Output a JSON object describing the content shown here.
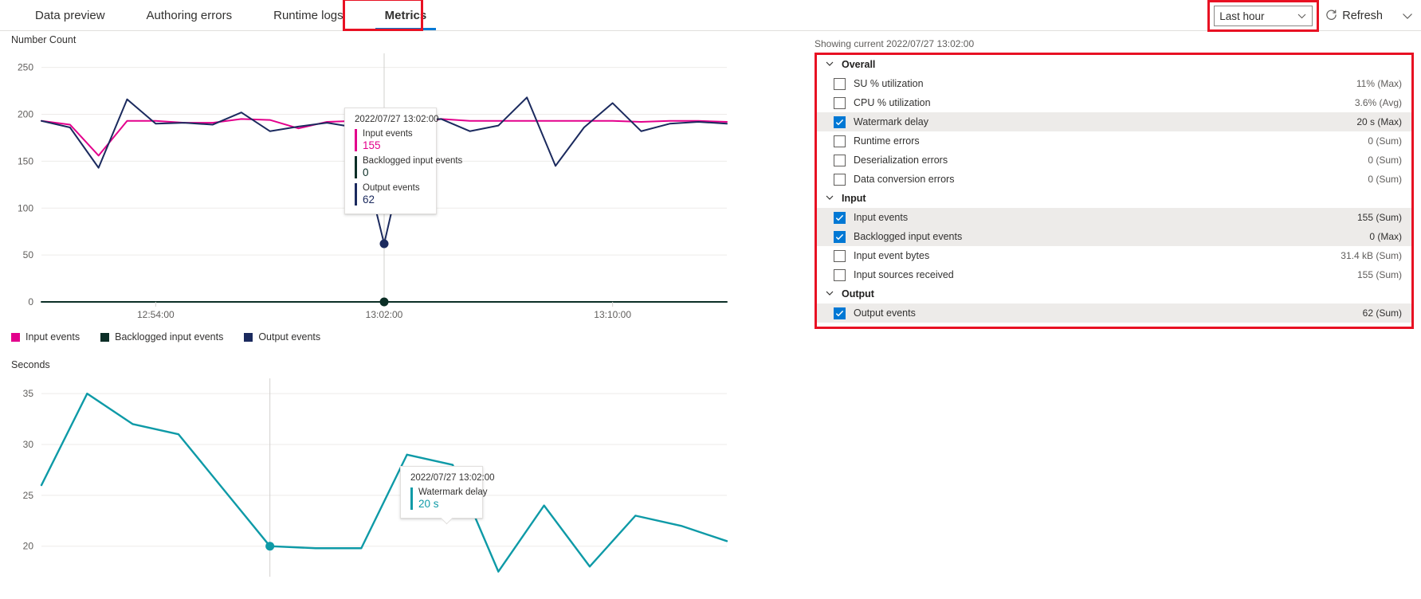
{
  "tabs": [
    {
      "label": "Data preview",
      "selected": false
    },
    {
      "label": "Authoring errors",
      "selected": false
    },
    {
      "label": "Runtime logs",
      "selected": false
    },
    {
      "label": "Metrics",
      "selected": true
    }
  ],
  "header": {
    "time_range": "Last hour",
    "refresh_label": "Refresh"
  },
  "showing_text": "Showing current 2022/07/27 13:02:00",
  "metrics_panel": {
    "groups": [
      {
        "name": "Overall",
        "items": [
          {
            "label": "SU % utilization",
            "value": "11% (Max)",
            "checked": false
          },
          {
            "label": "CPU % utilization",
            "value": "3.6% (Avg)",
            "checked": false
          },
          {
            "label": "Watermark delay",
            "value": "20 s (Max)",
            "checked": true
          },
          {
            "label": "Runtime errors",
            "value": "0 (Sum)",
            "checked": false
          },
          {
            "label": "Deserialization errors",
            "value": "0 (Sum)",
            "checked": false
          },
          {
            "label": "Data conversion errors",
            "value": "0 (Sum)",
            "checked": false
          }
        ]
      },
      {
        "name": "Input",
        "items": [
          {
            "label": "Input events",
            "value": "155 (Sum)",
            "checked": true
          },
          {
            "label": "Backlogged input events",
            "value": "0 (Max)",
            "checked": true
          },
          {
            "label": "Input event bytes",
            "value": "31.4 kB (Sum)",
            "checked": false
          },
          {
            "label": "Input sources received",
            "value": "155 (Sum)",
            "checked": false
          }
        ]
      },
      {
        "name": "Output",
        "items": [
          {
            "label": "Output events",
            "value": "62 (Sum)",
            "checked": true
          }
        ]
      }
    ]
  },
  "chart_data": [
    {
      "id": "number_count",
      "type": "line",
      "title": "",
      "ylabel": "Number Count",
      "xlabel": "",
      "ylim": [
        0,
        265
      ],
      "yticks": [
        0,
        50,
        100,
        150,
        200,
        250
      ],
      "xticks": [
        "12:54:00",
        "13:02:00",
        "13:10:00"
      ],
      "grid": true,
      "legend_position": "bottom-left",
      "x": [
        "12:50:00",
        "12:51:00",
        "12:52:00",
        "12:53:00",
        "12:54:00",
        "12:55:00",
        "12:56:00",
        "12:57:00",
        "12:58:00",
        "12:59:00",
        "13:00:00",
        "13:01:00",
        "13:02:00",
        "13:03:00",
        "13:04:00",
        "13:05:00",
        "13:06:00",
        "13:07:00",
        "13:08:00",
        "13:09:00",
        "13:10:00",
        "13:11:00",
        "13:12:00",
        "13:13:00",
        "13:14:00"
      ],
      "series": [
        {
          "name": "Input events",
          "color": "#e3008c",
          "values": [
            193,
            189,
            156,
            193,
            193,
            191,
            191,
            195,
            194,
            185,
            192,
            193,
            155,
            190,
            195,
            193,
            193,
            193,
            193,
            193,
            193,
            192,
            193,
            193,
            192
          ]
        },
        {
          "name": "Backlogged input events",
          "color": "#0b2e26",
          "values": [
            0,
            0,
            0,
            0,
            0,
            0,
            0,
            0,
            0,
            0,
            0,
            0,
            0,
            0,
            0,
            0,
            0,
            0,
            0,
            0,
            0,
            0,
            0,
            0,
            0
          ]
        },
        {
          "name": "Output events",
          "color": "#1b2a5e",
          "values": [
            193,
            186,
            143,
            216,
            190,
            191,
            189,
            202,
            182,
            187,
            191,
            186,
            62,
            194,
            195,
            182,
            188,
            218,
            145,
            186,
            212,
            182,
            190,
            192,
            190
          ]
        }
      ],
      "tooltip": {
        "time": "2022/07/27 13:02:00",
        "rows": [
          {
            "name": "Input events",
            "value": "155",
            "color": "#e3008c"
          },
          {
            "name": "Backlogged input events",
            "value": "0",
            "color": "#0b2e26"
          },
          {
            "name": "Output events",
            "value": "62",
            "color": "#1b2a5e"
          }
        ]
      }
    },
    {
      "id": "seconds",
      "type": "line",
      "title": "",
      "ylabel": "Seconds",
      "xlabel": "",
      "ylim": [
        17,
        36.5
      ],
      "yticks": [
        20,
        25,
        30,
        35
      ],
      "xticks": [],
      "grid": true,
      "legend_position": "none",
      "x": [
        "12:50:00",
        "12:51:00",
        "12:52:00",
        "12:54:00",
        "12:56:00",
        "13:02:00",
        "13:03:00",
        "13:04:00",
        "13:05:00",
        "13:06:00",
        "13:07:00",
        "13:08:00",
        "13:09:00",
        "13:10:00",
        "13:12:00",
        "13:14:00"
      ],
      "series": [
        {
          "name": "Watermark delay",
          "color": "#0e9aa7",
          "values": [
            26,
            35,
            32,
            31,
            25.5,
            20,
            19.8,
            19.8,
            29,
            28,
            17.5,
            24,
            18,
            23,
            22,
            20.5
          ]
        }
      ],
      "tooltip": {
        "time": "2022/07/27 13:02:00",
        "rows": [
          {
            "name": "Watermark delay",
            "value": "20 s",
            "color": "#0e9aa7"
          }
        ]
      }
    }
  ]
}
